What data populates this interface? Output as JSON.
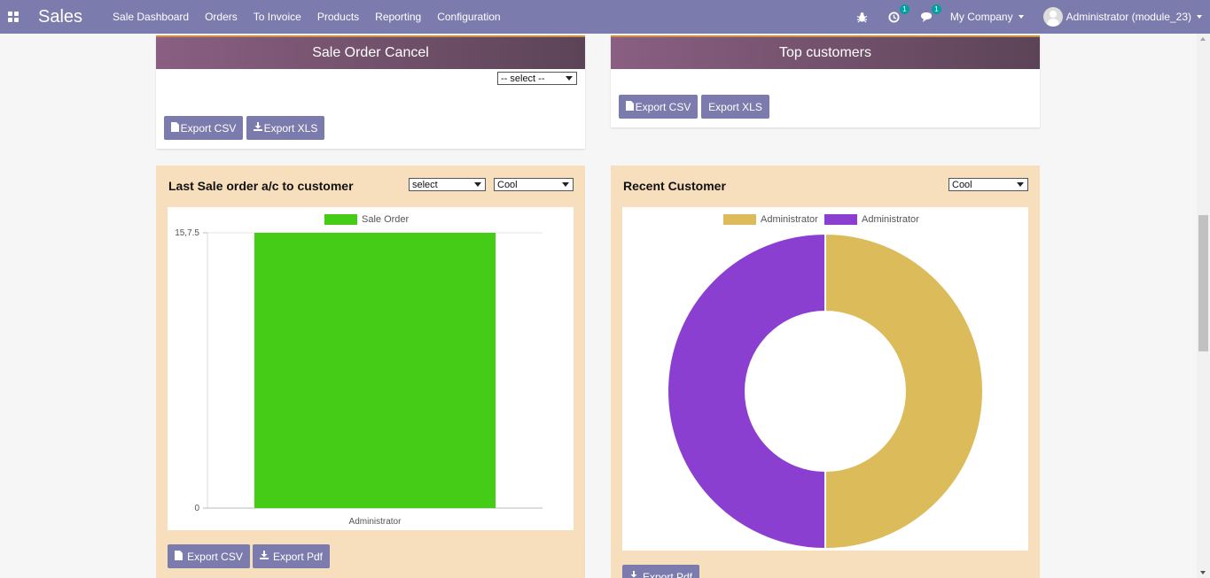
{
  "navbar": {
    "brand": "Sales",
    "menu": [
      "Sale Dashboard",
      "Orders",
      "To Invoice",
      "Products",
      "Reporting",
      "Configuration"
    ],
    "activity_badge": "1",
    "messages_badge": "1",
    "company": "My Company",
    "user": "Administrator (module_23)",
    "bar_color": "#7c7bad"
  },
  "cancel_card": {
    "title": "Sale Order Cancel",
    "select_value": "-- select --",
    "export_csv": "Export CSV",
    "export_xls": "Export XLS"
  },
  "top_customers_card": {
    "title": "Top customers",
    "export_csv": "Export CSV",
    "export_xls": "Export XLS"
  },
  "last_sale_panel": {
    "title": "Last Sale order a/c to customer",
    "select1_value": "select",
    "select2_value": "Cool",
    "export_csv": "Export CSV",
    "export_pdf": "Export Pdf"
  },
  "recent_customer_panel": {
    "title": "Recent Customer",
    "select_value": "Cool",
    "export_pdf": "Export Pdf"
  },
  "chart_data": [
    {
      "type": "bar",
      "categories": [
        "Administrator"
      ],
      "series": [
        {
          "name": "Sale Order",
          "values": [
            15.75
          ],
          "color": "#45cc16"
        }
      ],
      "y_ticks": [
        "0",
        "15,7.5"
      ],
      "ylim": [
        0,
        15.75
      ],
      "legend": "top",
      "grid": true
    },
    {
      "type": "pie",
      "donut": true,
      "labels": [
        "Administrator",
        "Administrator"
      ],
      "values": [
        1,
        1
      ],
      "colors": [
        "#dcbb5a",
        "#8b3fd0"
      ],
      "legend": "top"
    }
  ]
}
